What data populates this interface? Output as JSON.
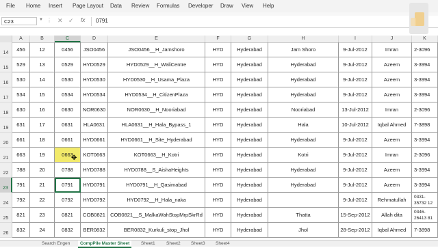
{
  "ribbon": {
    "tabs": [
      "File",
      "Home",
      "Insert",
      "Page Layout",
      "Data",
      "Review",
      "Formulas",
      "Developer",
      "Draw",
      "View",
      "Help"
    ]
  },
  "formula_bar": {
    "name_box": "C23",
    "fx_label": "fx",
    "content": "0791"
  },
  "columns": [
    "A",
    "B",
    "C",
    "D",
    "E",
    "F",
    "G",
    "H",
    "I",
    "J",
    "K"
  ],
  "selected_column": "C",
  "rows": [
    {
      "n": "14",
      "A": "456",
      "B": "12",
      "C": "0456",
      "D": "JSO0456",
      "E": "JSO0456__H_Jamshoro",
      "F": "HYD",
      "G": "Hyderabad",
      "H": "Jam Shoro",
      "I": "9-Jul-2012",
      "J": "Imran",
      "K": "2-3096"
    },
    {
      "n": "15",
      "A": "529",
      "B": "13",
      "C": "0529",
      "D": "HYD0529",
      "E": "HYD0529__H_WaliCentre",
      "F": "HYD",
      "G": "Hyderabad",
      "H": "Hyderabad",
      "I": "9-Jul-2012",
      "J": "Azeem",
      "K": "3-3994"
    },
    {
      "n": "16",
      "A": "530",
      "B": "14",
      "C": "0530",
      "D": "HYD0530",
      "E": "HYD0530__H_Usama_Plaza",
      "F": "HYD",
      "G": "Hyderabad",
      "H": "Hyderabad",
      "I": "9-Jul-2012",
      "J": "Azeem",
      "K": "3-3994"
    },
    {
      "n": "17",
      "A": "534",
      "B": "15",
      "C": "0534",
      "D": "HYD0534",
      "E": "HYD0534__H_CitizenPlaza",
      "F": "HYD",
      "G": "Hyderabad",
      "H": "Hyderabad",
      "I": "9-Jul-2012",
      "J": "Azeem",
      "K": "3-3994"
    },
    {
      "n": "18",
      "A": "630",
      "B": "16",
      "C": "0630",
      "D": "NOR0630",
      "E": "NOR0630__H_Nooriabad",
      "F": "HYD",
      "G": "Hyderabad",
      "H": "Nooriabad",
      "I": "13-Jul-2012",
      "J": "Imran",
      "K": "2-3096"
    },
    {
      "n": "19",
      "A": "631",
      "B": "17",
      "C": "0631",
      "D": "HLA0631",
      "E": "HLA0631__H_Hala_Bypass_1",
      "F": "HYD",
      "G": "Hyderabad",
      "H": "Hala",
      "I": "10-Jul-2012",
      "J": "Iqbal Ahmed",
      "K": "7-3898"
    },
    {
      "n": "20",
      "A": "661",
      "B": "18",
      "C": "0661",
      "D": "HYD0661",
      "E": "HYD0661__H_Site_Hyderabad",
      "F": "HYD",
      "G": "Hyderabad",
      "H": "Hyderabad",
      "I": "9-Jul-2012",
      "J": "Azeem",
      "K": "3-3994"
    },
    {
      "n": "21",
      "A": "663",
      "B": "19",
      "C": "0663",
      "D": "KOT0663",
      "E": "KOT0663__H_Kotri",
      "F": "HYD",
      "G": "Hyderabad",
      "H": "Kotri",
      "I": "9-Jul-2012",
      "J": "Imran",
      "K": "2-3096"
    },
    {
      "n": "22",
      "A": "788",
      "B": "20",
      "C": "0788",
      "D": "HYD0788",
      "E": "HYD0788__S_AishaHeights",
      "F": "HYD",
      "G": "Hyderabad",
      "H": "Hyderabad",
      "I": "9-Jul-2012",
      "J": "Azeem",
      "K": "3-3994"
    },
    {
      "n": "23",
      "A": "791",
      "B": "21",
      "C": "0791",
      "D": "HYD0791",
      "E": "HYD0791__H_Qasimabad",
      "F": "HYD",
      "G": "Hyderabad",
      "H": "Hyderabad",
      "I": "9-Jul-2012",
      "J": "Azeem",
      "K": "3-3994"
    },
    {
      "n": "24",
      "A": "792",
      "B": "22",
      "C": "0792",
      "D": "HYD0792",
      "E": "HYD0792__H_Hala_naka",
      "F": "HYD",
      "G": "Hyderabad",
      "H": "",
      "I": "9-Jul-2012",
      "J": "Rehmatullah",
      "K": "0331-35732 12"
    },
    {
      "n": "25",
      "A": "821",
      "B": "23",
      "C": "0821",
      "D": "COB0821",
      "E": "COB0821__S_MalkaWahStopMrpSkrRd",
      "F": "HYD",
      "G": "Hyderabad",
      "H": "Thatta",
      "I": "15-Sep-2012",
      "J": "Allah dita",
      "K": "0346-26413 81"
    },
    {
      "n": "26",
      "A": "832",
      "B": "24",
      "C": "0832",
      "D": "BER0832",
      "E": "BER0832_Kurkuli_stop_Jhol",
      "F": "HYD",
      "G": "Hyderabad",
      "H": "Jhol",
      "I": "28-Sep-2012",
      "J": "Iqbal Ahmed",
      "K": "7-3898"
    }
  ],
  "active_row": "23",
  "active_column": "C",
  "highlight_cell": {
    "row": "21",
    "col": "C"
  },
  "sheets": [
    "Search Engen",
    "CompPile Master Sheet",
    "Sheet1",
    "Sheet2",
    "Sheet3",
    "Sheet4"
  ],
  "active_sheet": "CompPile Master Sheet",
  "colors": {
    "accent": "#217346",
    "highlight": "#f2ea6a"
  },
  "icons": [
    "name-box-dropdown-icon",
    "cancel-x-icon",
    "enter-check-icon",
    "function-fx-icon",
    "cursor-icon",
    "logo-icon"
  ]
}
